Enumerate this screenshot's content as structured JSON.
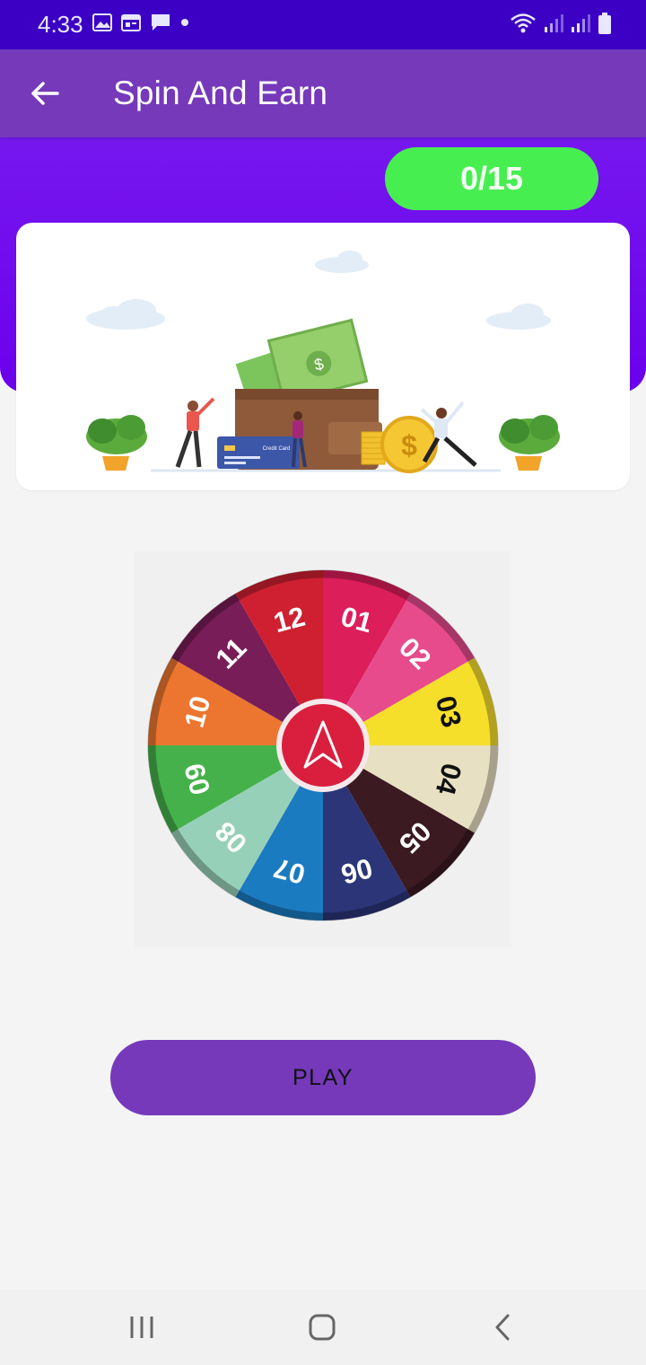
{
  "status_bar": {
    "time": "4:33"
  },
  "app_bar": {
    "title": "Spin And Earn"
  },
  "counter": {
    "text": "0/15"
  },
  "banner": {
    "credit_card_text": "Credit Card",
    "coin_symbol": "$",
    "cash_symbol": "$"
  },
  "wheel": {
    "segments": [
      {
        "label": "01",
        "color": "#dc1e5b",
        "text_color": "#ffffff"
      },
      {
        "label": "02",
        "color": "#e74b8c",
        "text_color": "#ffffff"
      },
      {
        "label": "03",
        "color": "#f5df2a",
        "text_color": "#111111"
      },
      {
        "label": "04",
        "color": "#e8e0c2",
        "text_color": "#111111"
      },
      {
        "label": "05",
        "color": "#3b1a22",
        "text_color": "#ffffff"
      },
      {
        "label": "06",
        "color": "#2b3578",
        "text_color": "#ffffff"
      },
      {
        "label": "07",
        "color": "#1a7bc0",
        "text_color": "#ffffff"
      },
      {
        "label": "08",
        "color": "#97d0b8",
        "text_color": "#ffffff"
      },
      {
        "label": "09",
        "color": "#45b14a",
        "text_color": "#ffffff"
      },
      {
        "label": "10",
        "color": "#ec7630",
        "text_color": "#ffffff"
      },
      {
        "label": "11",
        "color": "#781d57",
        "text_color": "#ffffff"
      },
      {
        "label": "12",
        "color": "#cf2031",
        "text_color": "#ffffff"
      }
    ],
    "pointer_color": "#d91f3d"
  },
  "play_button": {
    "label": "PLAY"
  },
  "colors": {
    "status_bar": "#3b00c4",
    "app_bar": "#7539ba",
    "header_bg": "#6b00ec",
    "counter": "#47ee4f",
    "play": "#7539ba"
  },
  "nav": {
    "items": [
      "recent-apps-icon",
      "home-icon",
      "back-icon"
    ]
  }
}
